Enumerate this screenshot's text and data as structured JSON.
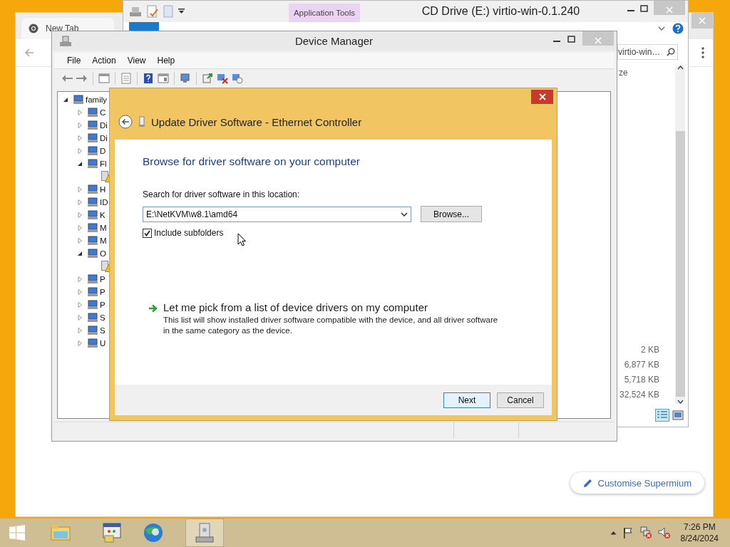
{
  "browser": {
    "tab": "New Tab",
    "customise_button": "Customise Supermium"
  },
  "explorer": {
    "title": "CD Drive (E:) virtio-win-0.1.240",
    "ribbon_tab": "Application Tools",
    "placeholder": "virtio-win…",
    "column_header": "ze",
    "sizes": [
      "2 KB",
      "6,877 KB",
      "5,718 KB",
      "32,524 KB"
    ]
  },
  "device_manager": {
    "title": "Device Manager",
    "menu": [
      "File",
      "Action",
      "View",
      "Help"
    ],
    "tree": [
      {
        "label": "family",
        "expanded": true,
        "children": [
          {
            "label": "C",
            "expanded": false
          },
          {
            "label": "Di",
            "expanded": false
          },
          {
            "label": "Di",
            "expanded": false
          },
          {
            "label": "D",
            "expanded": false
          },
          {
            "label": "Fl",
            "expanded": true,
            "children": [
              {
                "kind": "warning-device"
              }
            ]
          },
          {
            "label": "H",
            "expanded": false
          },
          {
            "label": "ID",
            "expanded": false
          },
          {
            "label": "K",
            "expanded": false
          },
          {
            "label": "M",
            "expanded": false
          },
          {
            "label": "M",
            "expanded": false
          },
          {
            "label": "O",
            "expanded": true,
            "children": [
              {
                "kind": "warning-device"
              }
            ]
          },
          {
            "label": "P",
            "expanded": false
          },
          {
            "label": "P",
            "expanded": false
          },
          {
            "label": "P",
            "expanded": false
          },
          {
            "label": "S",
            "expanded": false
          },
          {
            "label": "S",
            "expanded": false
          },
          {
            "label": "U",
            "expanded": false
          }
        ]
      }
    ]
  },
  "dialog": {
    "title": "Update Driver Software - Ethernet Controller",
    "heading": "Browse for driver software on your computer",
    "location_label": "Search for driver software in this location:",
    "location_value": "E:\\NetKVM\\w8.1\\amd64",
    "browse_button": "Browse...",
    "include_subfolders": {
      "label": "Include subfolders",
      "checked": true
    },
    "pick_link": "Let me pick from a list of device drivers on my computer",
    "pick_description": "This list will show installed driver software compatible with the device, and all driver software in the same category as the device.",
    "buttons": [
      {
        "label": "Next",
        "default": true
      },
      {
        "label": "Cancel",
        "default": false
      }
    ]
  },
  "taskbar": {
    "apps": [
      {
        "kind": "folder",
        "selected": false
      },
      {
        "kind": "window",
        "selected": false
      },
      {
        "kind": "globe",
        "selected": false
      },
      {
        "kind": "computer",
        "selected": true
      }
    ],
    "time": "7:26 PM",
    "date": "8/24/2024"
  }
}
